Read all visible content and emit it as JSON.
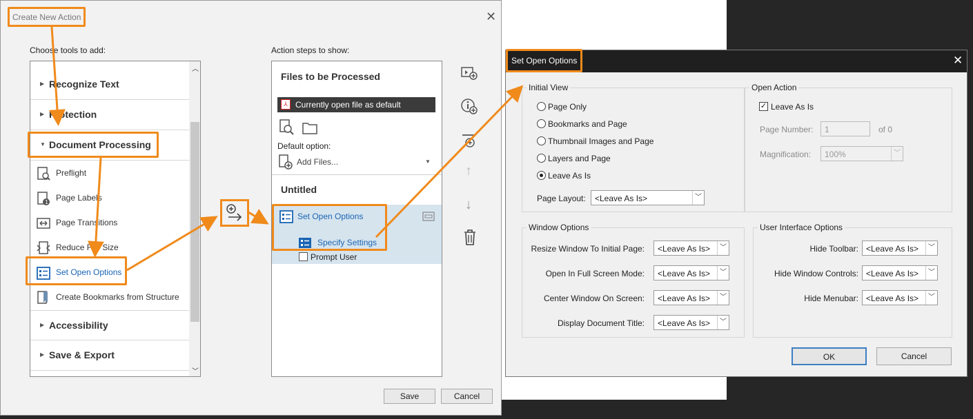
{
  "create_new_action": {
    "title": "Create New Action",
    "tools_label": "Choose tools to add:",
    "steps_label": "Action steps to show:",
    "categories": [
      {
        "name": "Recognize Text",
        "expanded": false
      },
      {
        "name": "Protection",
        "expanded": false
      },
      {
        "name": "Document Processing",
        "expanded": true
      },
      {
        "name": "Accessibility",
        "expanded": false
      },
      {
        "name": "Save & Export",
        "expanded": false
      }
    ],
    "tools": [
      {
        "name": "Preflight",
        "icon": "preflight-icon"
      },
      {
        "name": "Page Labels",
        "icon": "page-labels-icon"
      },
      {
        "name": "Page Transitions",
        "icon": "page-transitions-icon"
      },
      {
        "name": "Reduce File Size",
        "icon": "reduce-file-size-icon"
      },
      {
        "name": "Set Open Options",
        "icon": "set-open-options-icon"
      },
      {
        "name": "Create Bookmarks from Structure",
        "icon": "bookmark-icon"
      }
    ],
    "steps": {
      "files_heading": "Files to be Processed",
      "current_file": "Currently open file as default",
      "default_option_label": "Default option:",
      "add_files": "Add Files...",
      "untitled": "Untitled",
      "step_name": "Set Open Options",
      "specify_settings": "Specify Settings",
      "prompt_user": "Prompt User"
    },
    "save": "Save",
    "cancel": "Cancel"
  },
  "set_open_options": {
    "title": "Set Open Options",
    "initial_view": {
      "title": "Initial View",
      "options": [
        "Page Only",
        "Bookmarks and Page",
        "Thumbnail Images and Page",
        "Layers and Page",
        "Leave As Is"
      ],
      "selected": "Leave As Is",
      "page_layout_label": "Page Layout:",
      "page_layout_value": "<Leave As Is>"
    },
    "open_action": {
      "title": "Open Action",
      "leave_as_is": "Leave As Is",
      "page_number_label": "Page Number:",
      "page_number_value": "1",
      "of_label": "of 0",
      "magnification_label": "Magnification:",
      "magnification_value": "100%"
    },
    "window_options": {
      "title": "Window Options",
      "rows": [
        {
          "label": "Resize Window To Initial Page:",
          "value": "<Leave As Is>"
        },
        {
          "label": "Open In Full Screen Mode:",
          "value": "<Leave As Is>"
        },
        {
          "label": "Center Window On Screen:",
          "value": "<Leave As Is>"
        },
        {
          "label": "Display Document Title:",
          "value": "<Leave As Is>"
        }
      ]
    },
    "ui_options": {
      "title": "User Interface Options",
      "rows": [
        {
          "label": "Hide Toolbar:",
          "value": "<Leave As Is>"
        },
        {
          "label": "Hide Window Controls:",
          "value": "<Leave As Is>"
        },
        {
          "label": "Hide Menubar:",
          "value": "<Leave As Is>"
        }
      ]
    },
    "ok": "OK",
    "cancel": "Cancel"
  },
  "colors": {
    "highlight": "#f08a1b",
    "link_blue": "#1a64b3",
    "selection": "#d6e4ee"
  }
}
